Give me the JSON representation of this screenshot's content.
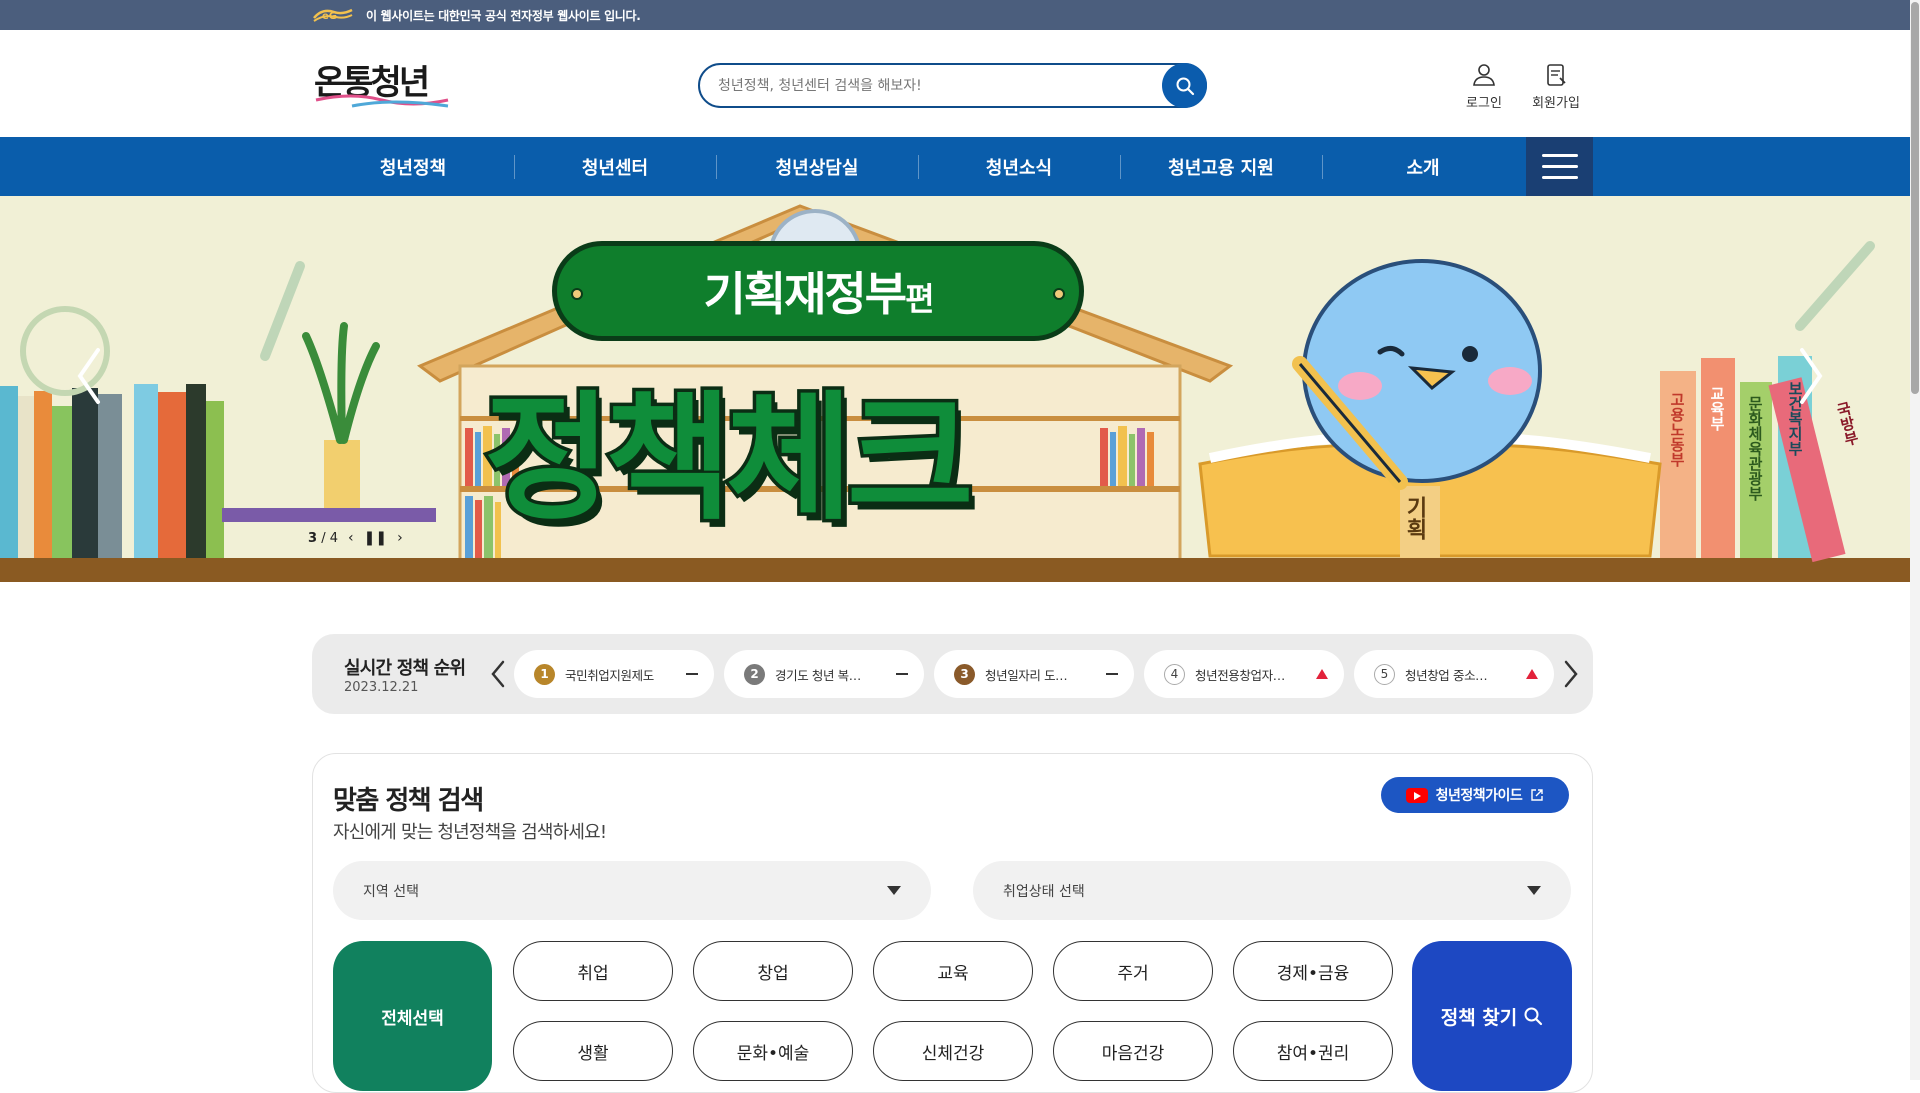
{
  "gov_notice": {
    "text": "이 웹사이트는 대한민국 공식 전자정부 웹사이트 입니다."
  },
  "brand": {
    "logo_text": "온통청년"
  },
  "search": {
    "placeholder": "청년정책, 청년센터 검색을 해보자!"
  },
  "util_menu": {
    "login": "로그인",
    "signup": "회원가입"
  },
  "nav": {
    "items": [
      "청년정책",
      "청년센터",
      "청년상담실",
      "청년소식",
      "청년고용 지원",
      "소개"
    ]
  },
  "banner": {
    "pill_text": "기획재정부",
    "pill_suffix": "편",
    "big_title": "정책체크",
    "book_labels": [
      "고용노동부",
      "교육부",
      "문화체육관광부",
      "보건복지부",
      "국방부"
    ],
    "book_spine": "기획",
    "current_slide": "3",
    "slide_sep": "/",
    "total_slides": "4"
  },
  "ranking": {
    "title": "실시간 정책 순위",
    "date": "2023.12.21",
    "items": [
      {
        "rank": "1",
        "text": "국민취업지원제도",
        "trend": "same"
      },
      {
        "rank": "2",
        "text": "경기도 청년 복…",
        "trend": "same"
      },
      {
        "rank": "3",
        "text": "청년일자리 도…",
        "trend": "same"
      },
      {
        "rank": "4",
        "text": "청년전용창업자…",
        "trend": "up"
      },
      {
        "rank": "5",
        "text": "청년창업 중소…",
        "trend": "up"
      }
    ]
  },
  "policy_search": {
    "title": "맞춤 정책 검색",
    "subtitle": "자신에게 맞는 청년정책을 검색하세요!",
    "guide_button": "청년정책가이드",
    "region_select": "지역 선택",
    "employment_select": "취업상태 선택",
    "all_button": "전체선택",
    "categories_row1": [
      "취업",
      "창업",
      "교육",
      "주거",
      "경제•금융"
    ],
    "categories_row2": [
      "생활",
      "문화•예술",
      "신체건강",
      "마음건강",
      "참여•권리"
    ],
    "find_button": "정책 찾기"
  },
  "colors": {
    "gov_bar": "#4b5e7d",
    "nav": "#0a5dab",
    "menu_button": "#1a3f73",
    "all_button": "#11815e",
    "find_button": "#1d48c2",
    "trend_up": "#e2223b"
  }
}
